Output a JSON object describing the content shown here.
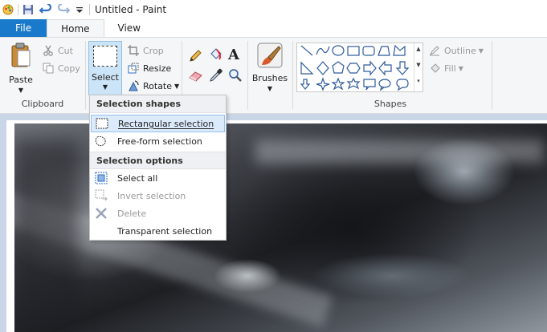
{
  "window": {
    "title": "Untitled - Paint"
  },
  "tabs": [
    {
      "label": "File"
    },
    {
      "label": "Home"
    },
    {
      "label": "View"
    }
  ],
  "clipboard": {
    "paste": "Paste",
    "cut": "Cut",
    "copy": "Copy",
    "group": "Clipboard"
  },
  "image": {
    "select": "Select",
    "crop": "Crop",
    "resize": "Resize",
    "rotate": "Rotate"
  },
  "brushes": {
    "label": "Brushes"
  },
  "shapes": {
    "outline": "Outline",
    "fill": "Fill",
    "group": "Shapes"
  },
  "select_menu": {
    "shapes_header": "Selection shapes",
    "rect": "Rectangular selection",
    "freeform": "Free-form selection",
    "options_header": "Selection options",
    "select_all": "Select all",
    "invert": "Invert selection",
    "delete": "Delete",
    "transparent": "Transparent selection"
  },
  "colors": {
    "file_tab": "#1979ca",
    "ribbon": "#f5f6f7",
    "workspace": "#c9d6e8",
    "hover": "#dcebfc"
  }
}
